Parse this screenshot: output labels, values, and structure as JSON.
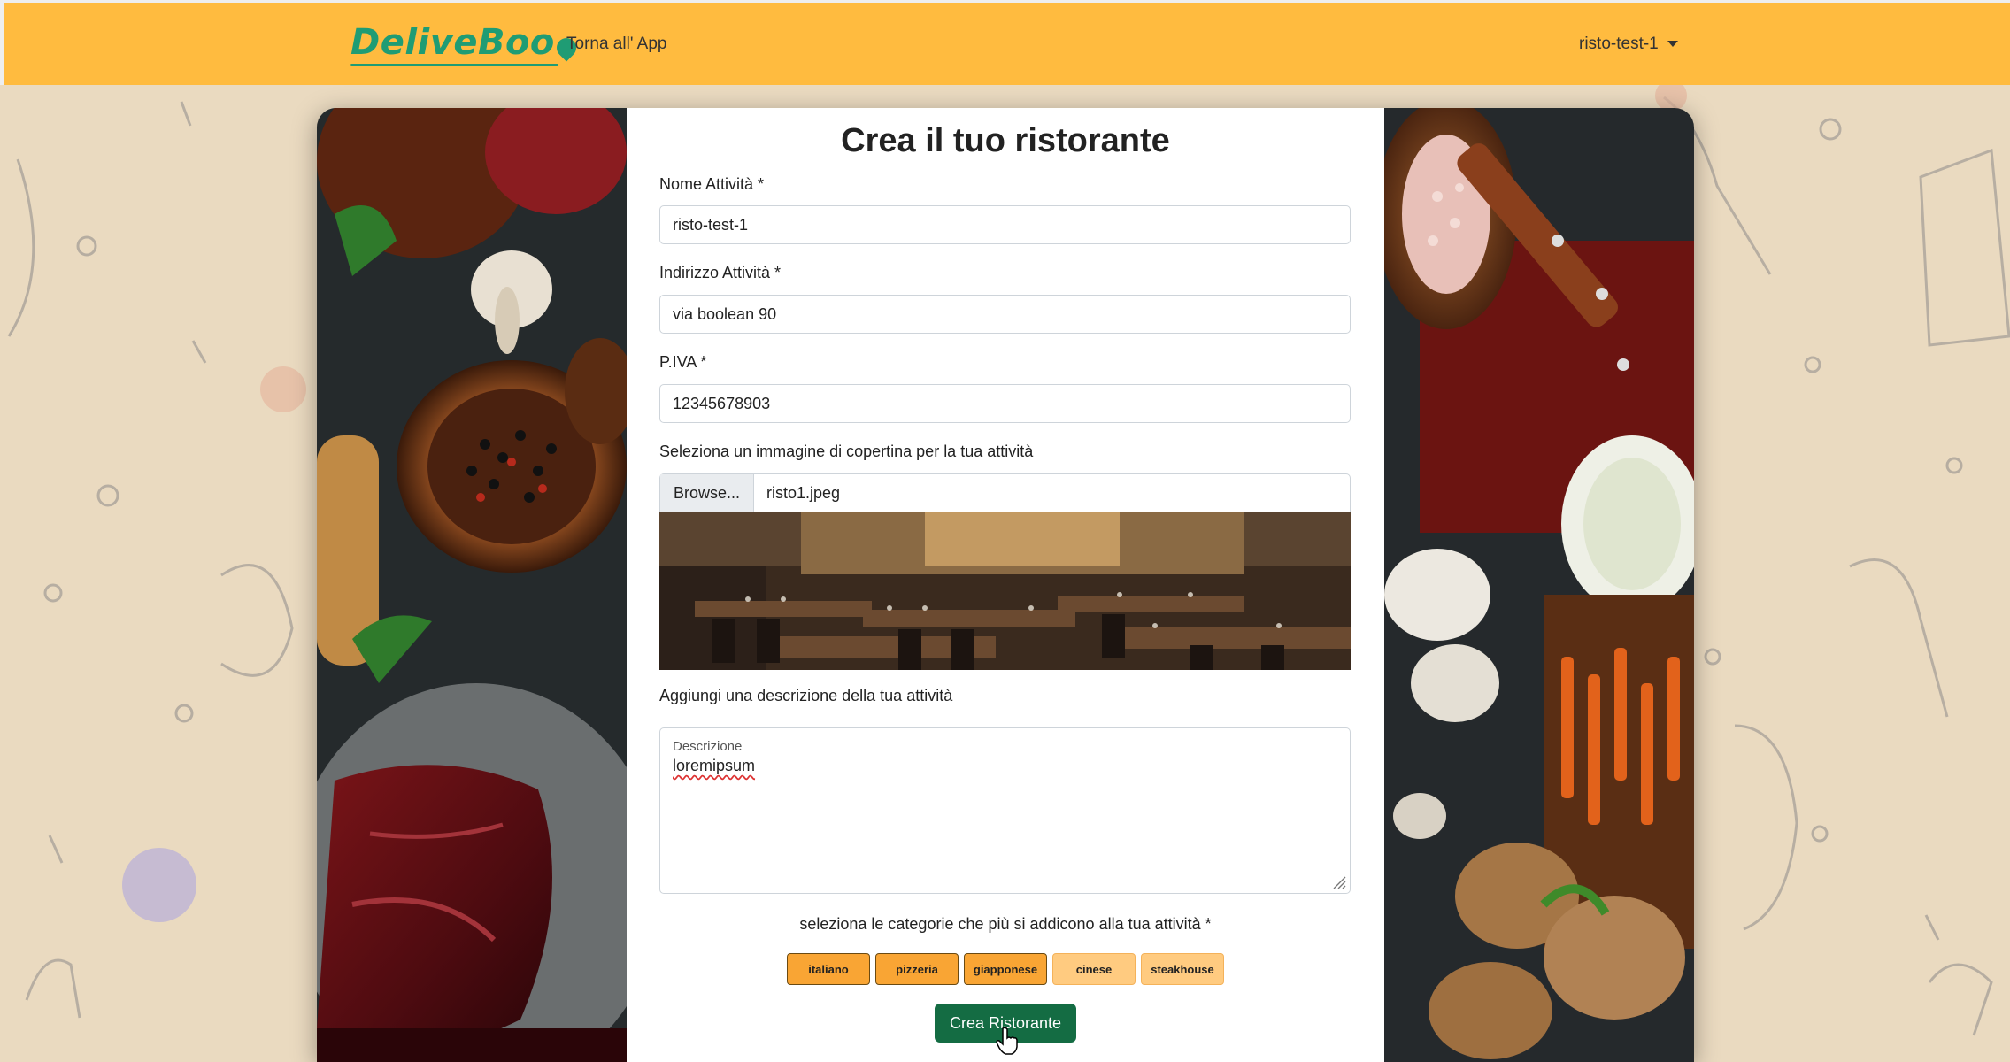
{
  "navbar": {
    "logo": "DeliveBoo",
    "back_link": "Torna all' App",
    "user": "risto-test-1"
  },
  "form": {
    "title": "Crea il tuo ristorante",
    "name_label": "Nome Attività *",
    "name_value": "risto-test-1",
    "address_label": "Indirizzo Attività *",
    "address_value": "via boolean 90",
    "vat_label": "P.IVA *",
    "vat_value": "12345678903",
    "image_label": "Seleziona un immagine di copertina per la tua attività",
    "browse_label": "Browse...",
    "file_name": "risto1.jpeg",
    "description_section_label": "Aggiungi una descrizione della tua attività",
    "description_placeholder": "Descrizione",
    "description_value": "loremipsum",
    "categories_label": "seleziona le categorie che più si addicono alla tua attività *",
    "categories": [
      {
        "label": "italiano",
        "selected": true
      },
      {
        "label": "pizzeria",
        "selected": true
      },
      {
        "label": "giapponese",
        "selected": true
      },
      {
        "label": "cinese",
        "selected": false
      },
      {
        "label": "steakhouse",
        "selected": false
      }
    ],
    "submit_label": "Crea Ristorante"
  },
  "colors": {
    "navbar": "#ffbb3f",
    "brand": "#1f9c74",
    "submit": "#146c43",
    "category_selected": "#f9a534",
    "category_unselected": "#ffcb80"
  }
}
